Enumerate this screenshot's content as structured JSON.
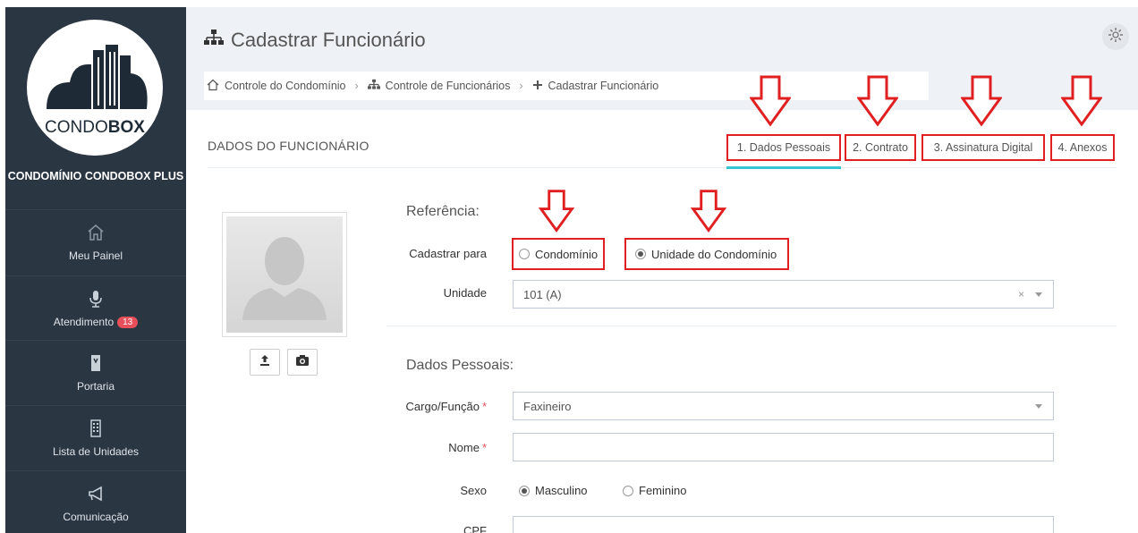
{
  "sidebar": {
    "logo_text_light": "CONDO",
    "logo_text_bold": "BOX",
    "condo_name": "CONDOMÍNIO CONDOBOX PLUS",
    "items": [
      {
        "label": "Meu Painel",
        "icon": "home-icon"
      },
      {
        "label": "Atendimento",
        "icon": "microphone-icon",
        "badge": "13"
      },
      {
        "label": "Portaria",
        "icon": "doorman-icon"
      },
      {
        "label": "Lista de Unidades",
        "icon": "building-icon"
      },
      {
        "label": "Comunicação",
        "icon": "megaphone-icon"
      }
    ]
  },
  "header": {
    "title": "Cadastrar Funcionário",
    "title_icon": "sitemap-icon",
    "settings_icon": "gear-icon"
  },
  "breadcrumb": [
    {
      "label": "Controle do Condomínio",
      "icon": "home-icon"
    },
    {
      "label": "Controle de Funcionários",
      "icon": "sitemap-icon"
    },
    {
      "label": "Cadastrar Funcionário",
      "icon": "plus-icon"
    }
  ],
  "panel": {
    "title": "DADOS DO FUNCIONÁRIO",
    "tabs": [
      {
        "label": "1. Dados Pessoais",
        "active": true
      },
      {
        "label": "2. Contrato",
        "active": false
      },
      {
        "label": "3. Assinatura Digital",
        "active": false
      },
      {
        "label": "4. Anexos",
        "active": false
      }
    ]
  },
  "form": {
    "referencia_title": "Referência:",
    "cadastrar_para_label": "Cadastrar para",
    "cadastrar_para_options": [
      {
        "label": "Condomínio",
        "selected": false
      },
      {
        "label": "Unidade do Condomínio",
        "selected": true
      }
    ],
    "unidade_label": "Unidade",
    "unidade_value": "101 (A)",
    "unidade_clear": "×",
    "dados_pessoais_title": "Dados Pessoais:",
    "cargo_label": "Cargo/Função",
    "cargo_value": "Faxineiro",
    "nome_label": "Nome",
    "nome_value": "",
    "required_mark": "*",
    "sexo_label": "Sexo",
    "sexo_options": [
      {
        "label": "Masculino",
        "selected": true
      },
      {
        "label": "Feminino",
        "selected": false
      }
    ],
    "cpf_label": "CPF",
    "cpf_value": ""
  },
  "colors": {
    "sidebar_bg": "#2b3643",
    "accent": "#36c6d3",
    "annotation_red": "#e02020",
    "badge": "#e7505a"
  }
}
